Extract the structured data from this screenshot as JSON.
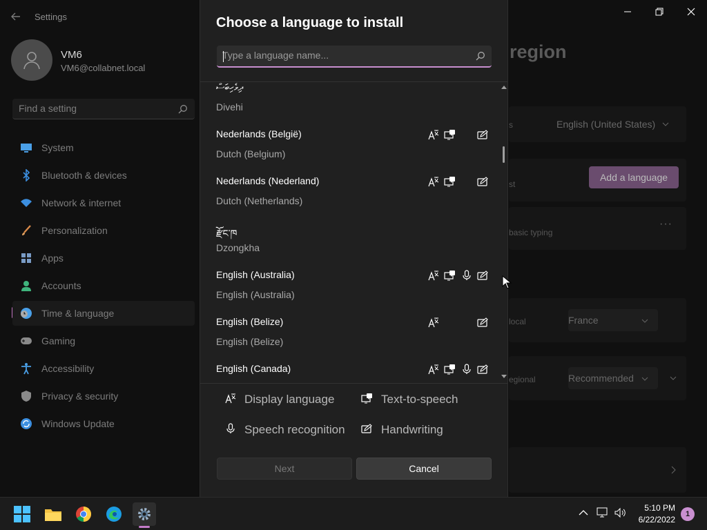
{
  "settings": {
    "app_title": "Settings",
    "user": {
      "name": "VM6",
      "email": "VM6@collabnet.local"
    },
    "search_placeholder": "Find a setting",
    "nav": [
      {
        "label": "System",
        "icon": "system-icon",
        "color": "#4aa0e8"
      },
      {
        "label": "Bluetooth & devices",
        "icon": "bluetooth-icon",
        "color": "#3c8fe0"
      },
      {
        "label": "Network & internet",
        "icon": "wifi-icon",
        "color": "#3c8fe0"
      },
      {
        "label": "Personalization",
        "icon": "brush-icon",
        "color": "#d98a4a"
      },
      {
        "label": "Apps",
        "icon": "apps-icon",
        "color": "#7a9cc6"
      },
      {
        "label": "Accounts",
        "icon": "accounts-icon",
        "color": "#3fb47c"
      },
      {
        "label": "Time & language",
        "icon": "globe-clock-icon",
        "color": "#4aa0e8",
        "selected": true
      },
      {
        "label": "Gaming",
        "icon": "gamepad-icon",
        "color": "#8a8a8a"
      },
      {
        "label": "Accessibility",
        "icon": "accessibility-icon",
        "color": "#4aa0e8"
      },
      {
        "label": "Privacy & security",
        "icon": "shield-icon",
        "color": "#8a8a8a"
      },
      {
        "label": "Windows Update",
        "icon": "update-icon",
        "color": "#3c8fe0"
      }
    ],
    "page_title_fragment": "region",
    "right": {
      "display_lang_value": "English (United States)",
      "add_language": "Add a language",
      "fragment_st": "st",
      "fragment_s": "s",
      "basic_typing": "basic typing",
      "local_label": "local",
      "country_value": "France",
      "regional_label": "egional",
      "format_value": "Recommended"
    }
  },
  "dialog": {
    "title": "Choose a language to install",
    "search_placeholder": "Type a language name...",
    "languages": [
      {
        "native": "ދިވެހިބަސް",
        "english": "Divehi",
        "display": false,
        "tts": false,
        "speech": false,
        "handwriting": false
      },
      {
        "native": "Nederlands (België)",
        "english": "Dutch (Belgium)",
        "display": true,
        "tts": true,
        "speech": false,
        "handwriting": true
      },
      {
        "native": "Nederlands (Nederland)",
        "english": "Dutch (Netherlands)",
        "display": true,
        "tts": true,
        "speech": false,
        "handwriting": true
      },
      {
        "native": "རྫོང་ཁ",
        "english": "Dzongkha",
        "display": false,
        "tts": false,
        "speech": false,
        "handwriting": false
      },
      {
        "native": "English (Australia)",
        "english": "English (Australia)",
        "display": true,
        "tts": true,
        "speech": true,
        "handwriting": true
      },
      {
        "native": "English (Belize)",
        "english": "English (Belize)",
        "display": true,
        "tts": false,
        "speech": false,
        "handwriting": true
      },
      {
        "native": "English (Canada)",
        "english": "English (Canada)",
        "display": true,
        "tts": true,
        "speech": true,
        "handwriting": true
      }
    ],
    "legend": {
      "display": "Display language",
      "tts": "Text-to-speech",
      "speech": "Speech recognition",
      "handwriting": "Handwriting"
    },
    "next_label": "Next",
    "cancel_label": "Cancel"
  },
  "taskbar": {
    "time": "5:10 PM",
    "date": "6/22/2022",
    "notification_count": "1",
    "apps": [
      "start-icon",
      "file-explorer-icon",
      "chrome-icon",
      "edge-icon",
      "settings-icon"
    ]
  }
}
